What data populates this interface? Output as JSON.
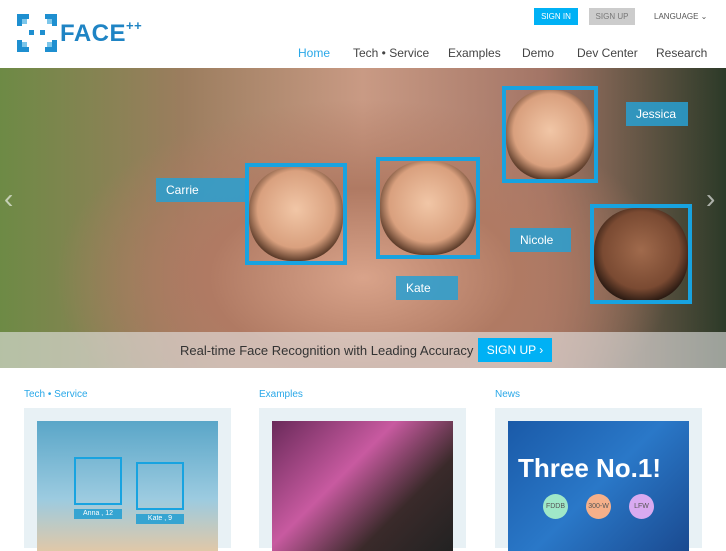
{
  "header": {
    "logo_text": "FACE",
    "logo_sup": "++",
    "sign_in": "SIGN IN",
    "sign_up": "SIGN UP",
    "language": "LANGUAGE ⌄",
    "nav": [
      {
        "label": "Home",
        "active": true
      },
      {
        "label": "Tech • Service"
      },
      {
        "label": "Examples"
      },
      {
        "label": "Demo"
      },
      {
        "label": "Dev Center"
      },
      {
        "label": "Research"
      }
    ]
  },
  "hero": {
    "labels": [
      "Carrie",
      "Kate",
      "Jessica",
      "Nicole"
    ],
    "caption": "Real-time Face Recognition with Leading Accuracy",
    "cta": "SIGN UP ›",
    "prev": "‹",
    "next": "›"
  },
  "sections": [
    {
      "title": "Tech • Service",
      "tags": [
        "Anna , 12",
        "Kate , 9"
      ]
    },
    {
      "title": "Examples"
    },
    {
      "title": "News",
      "headline": "Three No.1!",
      "badges": [
        "FDDB",
        "300-W",
        "LFW"
      ]
    }
  ],
  "colors": {
    "accent": "#00b1f5",
    "brand": "#1f84c4"
  }
}
